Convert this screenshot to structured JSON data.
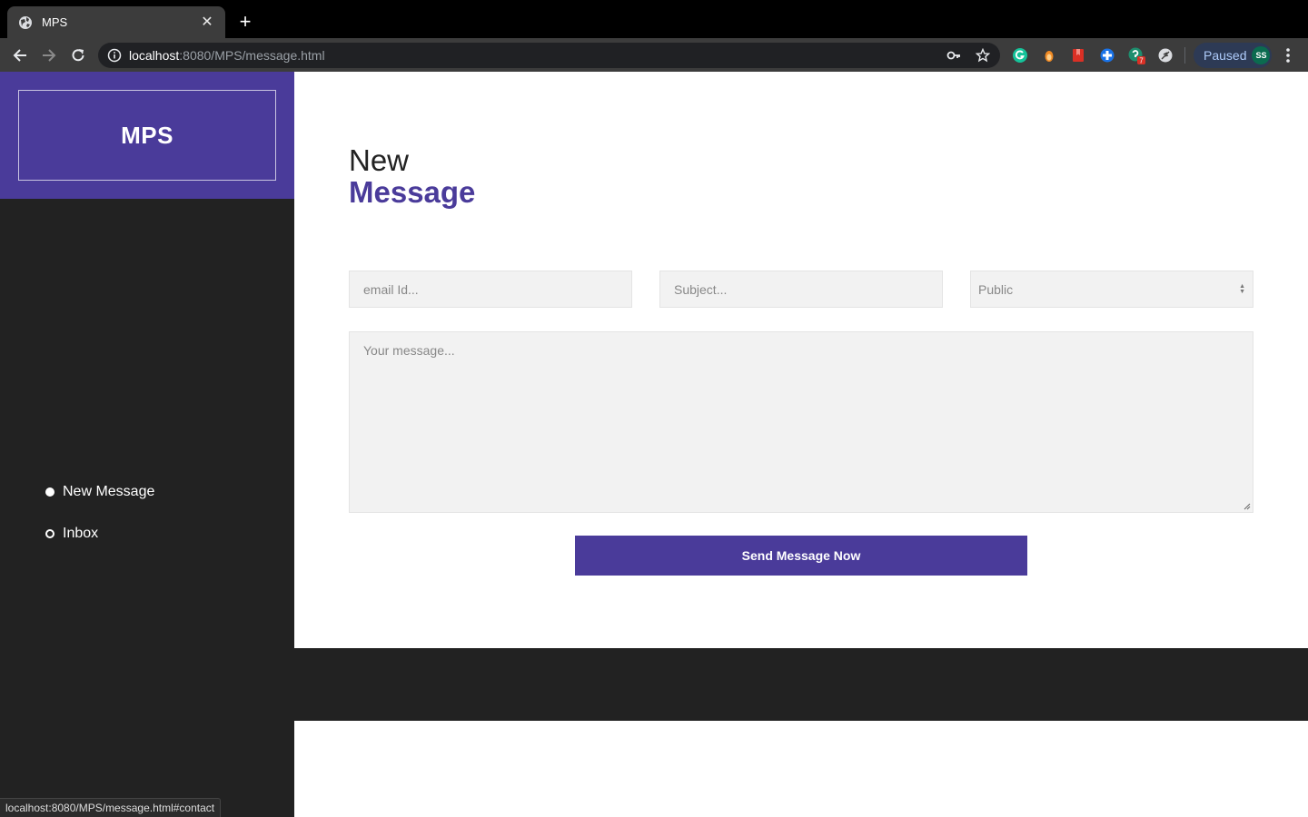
{
  "browser": {
    "tab_title": "MPS",
    "tab_close": "✕",
    "new_tab": "+",
    "url_host": "localhost",
    "url_path": ":8080/MPS/message.html",
    "profile_status": "Paused",
    "profile_initials": "SS",
    "extension_badge": "7",
    "status_url": "localhost:8080/MPS/message.html#contact"
  },
  "sidebar": {
    "brand": "MPS",
    "items": [
      {
        "label": "New Message",
        "active": true
      },
      {
        "label": "Inbox",
        "active": false
      }
    ]
  },
  "main": {
    "heading_line1": "New",
    "heading_line2": "Message",
    "email_placeholder": "email Id...",
    "subject_placeholder": "Subject...",
    "visibility_value": "Public",
    "message_placeholder": "Your message...",
    "send_label": "Send Message Now"
  },
  "colors": {
    "accent": "#4a3b9a",
    "sidebar_bg": "#222222",
    "field_bg": "#f2f2f2"
  }
}
